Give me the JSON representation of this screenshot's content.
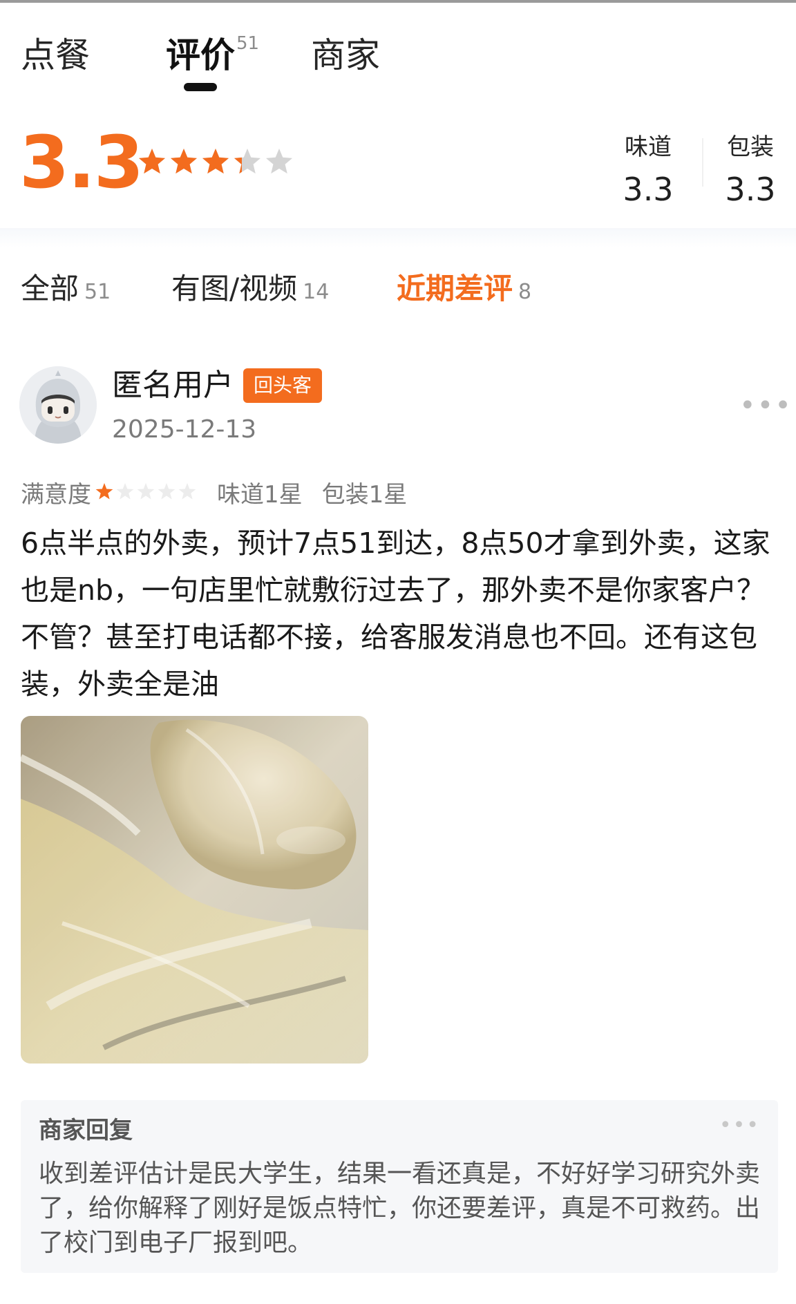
{
  "tabs": {
    "order": "点餐",
    "reviews": "评价",
    "reviews_count": "51",
    "merchant": "商家"
  },
  "summary": {
    "score": "3.3",
    "stars_filled": 3.3,
    "stars_total": 5,
    "taste_label": "味道",
    "taste_value": "3.3",
    "packaging_label": "包装",
    "packaging_value": "3.3"
  },
  "filters": [
    {
      "label": "全部",
      "count": "51"
    },
    {
      "label": "有图/视频",
      "count": "14"
    },
    {
      "label": "近期差评",
      "count": "8"
    }
  ],
  "review": {
    "username": "匿名用户",
    "badge": "回头客",
    "date": "2025-12-13",
    "satisfaction_label": "满意度",
    "satisfaction_stars": 1,
    "taste_rating": "味道1星",
    "packaging_rating": "包装1星",
    "text": "6点半点的外卖，预计7点51到达，8点50才拿到外卖，这家也是nb，一句店里忙就敷衍过去了，那外卖不是你家客户？不管？甚至打电话都不接，给客服发消息也不回。还有这包装，外卖全是油"
  },
  "reply": {
    "title": "商家回复",
    "text": "收到差评估计是民大学生，结果一看还真是，不好好学习研究外卖了，给你解释了刚好是饭点特忙，你还要差评，真是不可救药。出了校门到电子厂报到吧。"
  },
  "icons": {
    "more": "more-horizontal-icon",
    "star": "star-icon",
    "avatar": "default-avatar-icon"
  },
  "colors": {
    "accent": "#f36c1e",
    "star_empty": "#d4d4d4",
    "text_secondary": "#7a7a7a"
  }
}
